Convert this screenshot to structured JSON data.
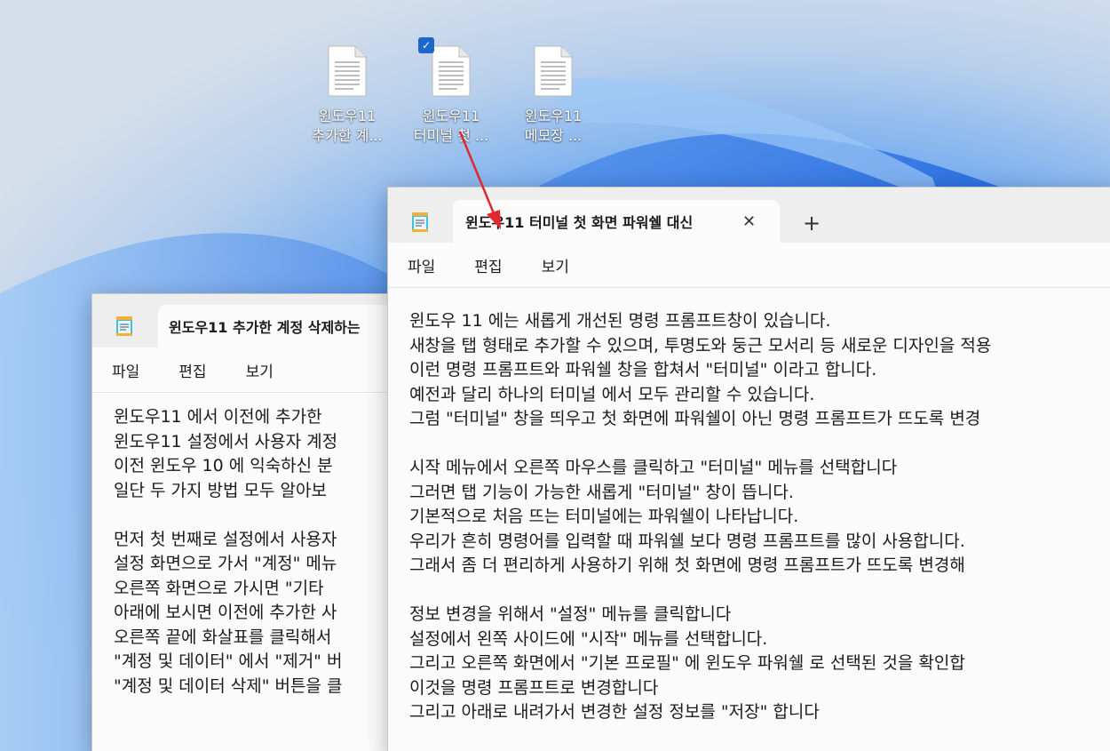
{
  "desktop": {
    "icons": [
      {
        "line1": "윈도우11",
        "line2": "추가한 계..."
      },
      {
        "line1": "윈도우11",
        "line2": "터미널 첫 ..."
      },
      {
        "line1": "윈도우11",
        "line2": "메모장 ..."
      }
    ]
  },
  "back_window": {
    "tab_title": "윈도우11 추가한 계정 삭제하는",
    "menu": [
      "파일",
      "편집",
      "보기"
    ],
    "lines": [
      "윈도우11 에서 이전에 추가한",
      "윈도우11 설정에서 사용자 계정",
      "이전 윈도우 10 에 익숙하신 분",
      "일단 두 가지 방법 모두 알아보",
      "",
      "먼저 첫 번째로 설정에서 사용자",
      "설정 화면으로 가서 \"계정\" 메뉴",
      "오른쪽 화면으로 가시면 \"기타",
      "아래에 보시면 이전에 추가한 사",
      "오른쪽 끝에 화살표를 클릭해서",
      "\"계정 및 데이터\" 에서 \"제거\" 버",
      "\"계정 및 데이터 삭제\" 버튼을 클"
    ]
  },
  "front_window": {
    "tab_title": "윈도우11 터미널 첫 화면 파워쉘 대신",
    "close_glyph": "✕",
    "new_tab_glyph": "+",
    "menu": [
      "파일",
      "편집",
      "보기"
    ],
    "lines": [
      "윈도우 11 에는 새롭게 개선된 명령 프롬프트창이 있습니다.",
      "새창을 탭 형태로 추가할 수 있으며, 투명도와 둥근 모서리 등 새로운 디자인을 적용",
      "이런 명령 프롬프트와 파워쉘 창을 합쳐서 \"터미널\" 이라고 합니다.",
      "예전과 달리 하나의 터미널 에서 모두 관리할 수 있습니다.",
      "그럼 \"터미널\" 창을 띄우고 첫 화면에 파워쉘이 아닌 명령 프롬프트가 뜨도록 변경",
      "",
      "시작 메뉴에서 오른쪽 마우스를 클릭하고 \"터미널\" 메뉴를 선택합니다",
      "그러면 탭 기능이 가능한 새롭게 \"터미널\" 창이 뜹니다.",
      "기본적으로 처음 뜨는 터미널에는 파워쉘이 나타납니다.",
      "우리가 흔히 명령어를 입력할 때 파워쉘 보다 명령 프롬프트를 많이 사용합니다.",
      "그래서 좀 더 편리하게 사용하기 위해 첫 화면에 명령 프롬프트가 뜨도록 변경해",
      "",
      "정보 변경을 위해서 \"설정\" 메뉴를 클릭합니다",
      "설정에서 왼쪽 사이드에 \"시작\" 메뉴를 선택합니다.",
      "그리고 오른쪽 화면에서 \"기본 프로필\" 에 윈도우 파워쉘 로 선택된 것을 확인합",
      "이것을 명령 프롬프트로 변경합니다",
      "그리고 아래로 내려가서 변경한 설정 정보를 \"저장\" 합니다"
    ]
  },
  "colors": {
    "accent": "#1e66c8",
    "arrow": "#e0282e"
  }
}
